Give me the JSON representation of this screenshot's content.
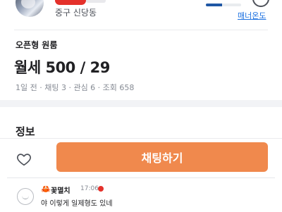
{
  "seller": {
    "location": "중구 신당동"
  },
  "manner": {
    "label": "매너온도",
    "level": 0.45,
    "accent_color": "#1f57a4",
    "icon": "smile-face-icon"
  },
  "listing": {
    "type": "오픈형 원룸",
    "price": "월세 500 / 29",
    "meta": "1일 전 · 채팅 3 · 관심 6 · 조회 658"
  },
  "section": {
    "title": "정보"
  },
  "actions": {
    "like_icon": "heart-outline-icon",
    "chat_label": "채팅하기",
    "chat_color": "#f0894d"
  },
  "comment": {
    "icon": "crab-icon",
    "author": "꽃멸치",
    "time": "17:06",
    "text": "야 이렇게 일제형도 있네"
  }
}
